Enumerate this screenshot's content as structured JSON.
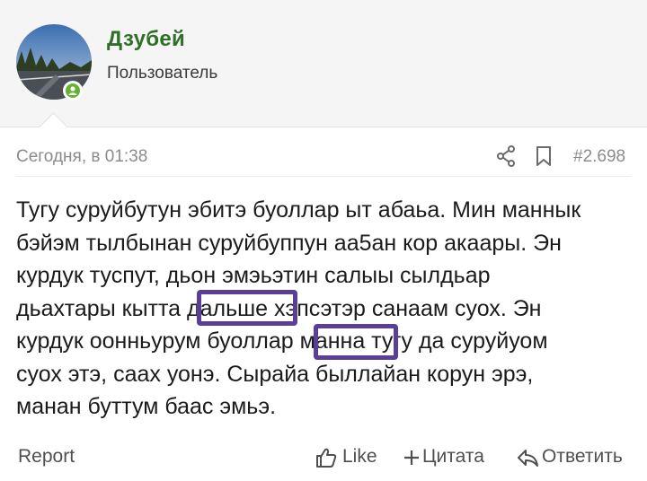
{
  "user": {
    "name": "Дзубей",
    "title": "Пользователь"
  },
  "post": {
    "time": "Сегодня, в 01:38",
    "number": "#2.698",
    "lines": [
      "Тугу суруйбутун эбитэ буоллар ыт абаьа. Мин маннык",
      "бэйэм тылбынан суруйбуппун аа5ан кор акаары. Эн",
      "курдук туспут, дьон эмэьэтин салыы сылдьар",
      "дьахтары кытта дальше хэпсэтэр санаам суох. Эн",
      "курдук оонньурум буоллар манна тугу да суруйуом",
      "суох этэ, саах уонэ. Сырайа быллайан корун эрэ,",
      "манан буттум баас эмьэ."
    ],
    "highlighted_words": [
      "дальше",
      "манна"
    ]
  },
  "actions": {
    "report": "Report",
    "like": "Like",
    "quote": "Цитата",
    "reply": "Ответить"
  },
  "colors": {
    "username": "#2f6f28",
    "online": "#63b32e",
    "highlight_box": "#5a3f98"
  },
  "icons": [
    "share-icon",
    "bookmark-icon",
    "thumbs-up-icon",
    "plus-icon",
    "reply-icon"
  ]
}
